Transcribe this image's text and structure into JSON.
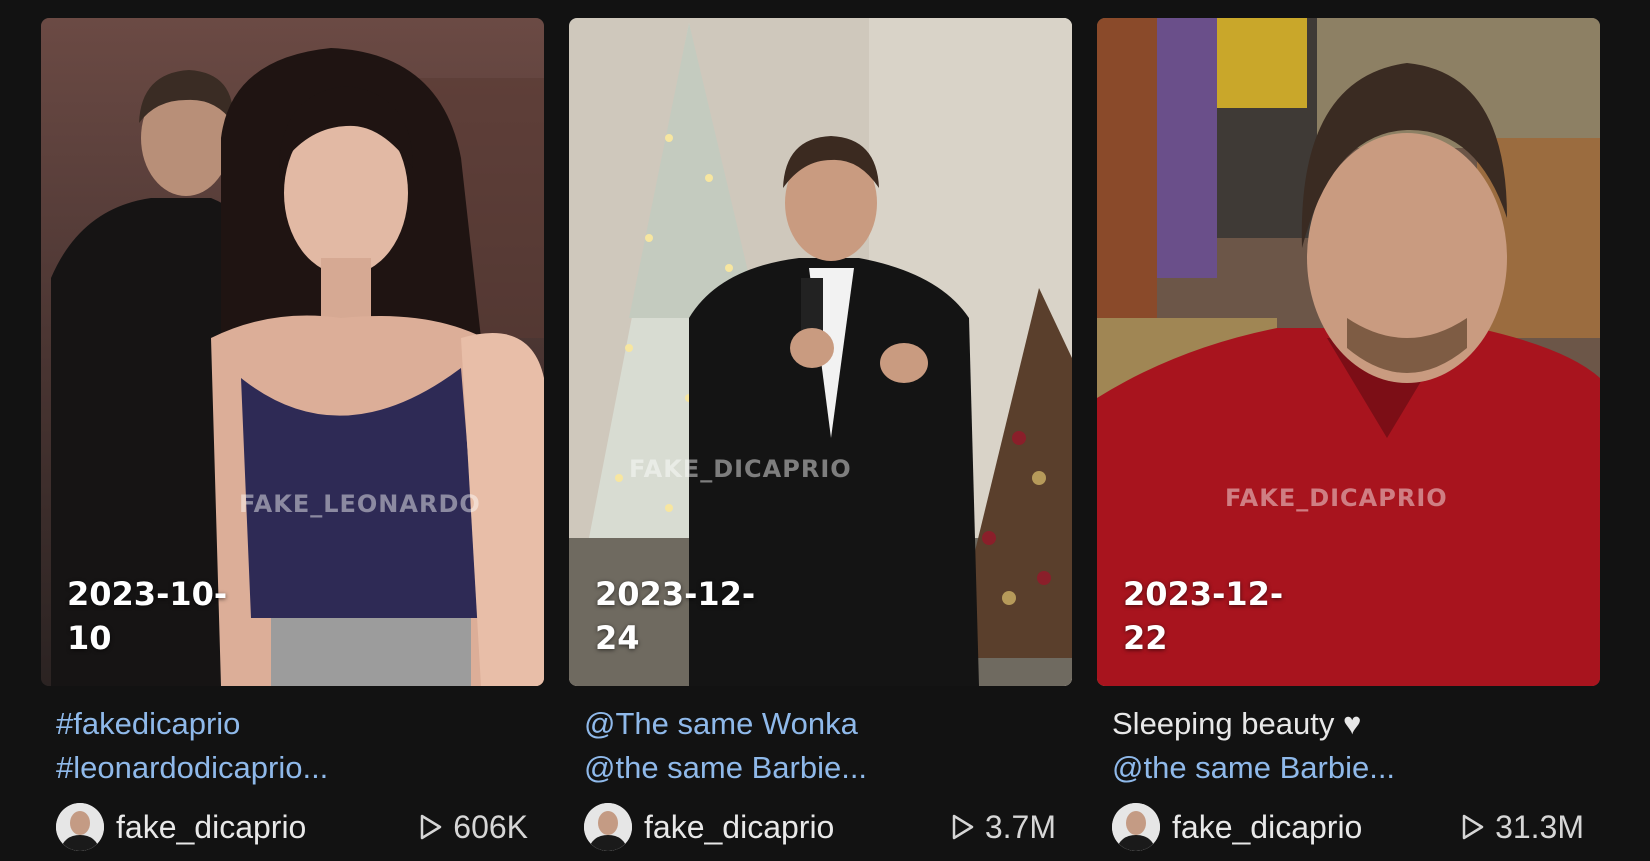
{
  "videos": [
    {
      "date": "2023-10-10",
      "watermark": "FAKE_LEONARDO",
      "caption_line1": "#fakedicaprio",
      "caption_line2": "#leonardodicaprio...",
      "username": "fake_dicaprio",
      "views": "606K"
    },
    {
      "date": "2023-12-24",
      "watermark": "FAKE_DICAPRIO",
      "caption_line1": "@The same Wonka",
      "caption_line2": "@the same Barbie...",
      "username": "fake_dicaprio",
      "views": "3.7M"
    },
    {
      "date": "2023-12-22",
      "watermark": "FAKE_DICAPRIO",
      "caption_line1": "Sleeping beauty ♥",
      "caption_line2": "@the same Barbie...",
      "username": "fake_dicaprio",
      "views": "31.3M"
    }
  ],
  "colors": {
    "background": "#121212",
    "link": "#8fb9ea",
    "text": "#e8e8e8"
  },
  "icons": {
    "views": "play-icon",
    "avatar": "avatar"
  }
}
